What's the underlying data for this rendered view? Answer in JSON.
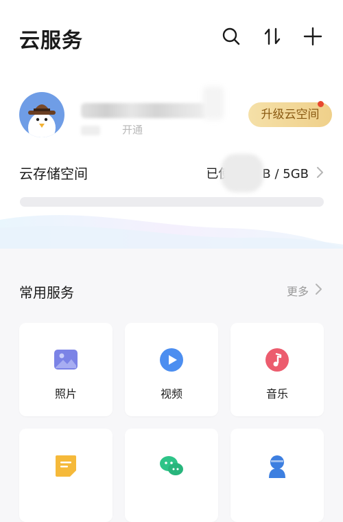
{
  "header": {
    "title": "云服务",
    "icons": [
      "search-icon",
      "transfer-icon",
      "add-icon"
    ]
  },
  "account": {
    "avatar_icon": "penguin-detective-avatar",
    "sub_text": "开通",
    "upgrade_label": "升级云空间"
  },
  "storage": {
    "label": "云存储空间",
    "value_prefix": "已使",
    "value_suffix": "B / 5GB"
  },
  "services": {
    "title": "常用服务",
    "more_label": "更多",
    "items": [
      {
        "label": "照片",
        "icon": "photo-icon",
        "color": "#7b83e6"
      },
      {
        "label": "视频",
        "icon": "video-play-icon",
        "color": "#4c8ef0"
      },
      {
        "label": "音乐",
        "icon": "music-note-icon",
        "color": "#ec5c6e"
      },
      {
        "label": "",
        "icon": "note-icon",
        "color": "#f5b93a"
      },
      {
        "label": "",
        "icon": "chat-icon",
        "color": "#2ec488"
      },
      {
        "label": "",
        "icon": "contact-icon",
        "color": "#3d7fe0"
      }
    ]
  },
  "colors": {
    "upgrade_bg": "#f2d796",
    "upgrade_text": "#8a5a12",
    "badge": "#e8472f"
  }
}
